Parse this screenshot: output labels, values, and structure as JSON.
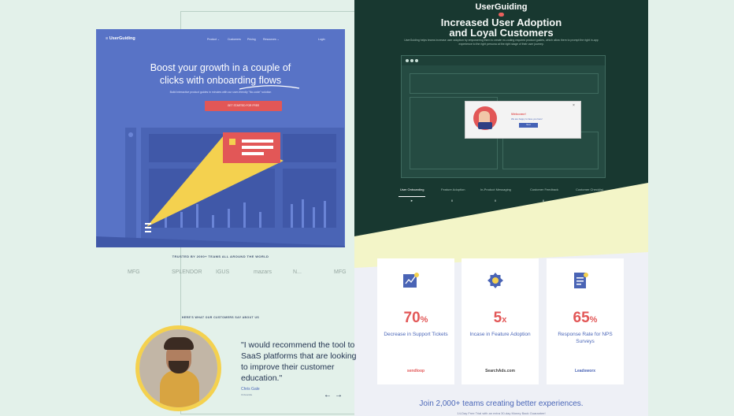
{
  "right": {
    "brand": "UserGuiding",
    "title_line1": "Increased User Adoption",
    "title_line2": "and Loyal Customers",
    "subtitle": "UserGuiding helps teams increase user adoption by empowering them to create no-coding required product guides, which allow them to prompt the right in-app experience to the right persona at the right stage of their user journey.",
    "popup": {
      "title": "Welcome!",
      "text": "We are happy to have you here!",
      "button": "Next",
      "close": "×"
    },
    "tabs": [
      "User Onboarding",
      "Feature Adoption",
      "In-Product Messaging",
      "Customer Feedback",
      "Customer Checklist"
    ],
    "tab_icons": [
      "►",
      "II",
      "II",
      "II",
      "II"
    ],
    "cards": [
      {
        "stat": "70",
        "unit": "%",
        "desc": "Decrease in Support Tickets",
        "brand": "sendloop"
      },
      {
        "stat": "5",
        "unit": "x",
        "desc": "Incase in Feature Adoption",
        "brand": "SearchAds.com"
      },
      {
        "stat": "65",
        "unit": "%",
        "desc": "Response Rate for NPS Surveys",
        "brand": "Leadsworx"
      }
    ],
    "join": "Join 2,000+ teams creating better experiences.",
    "join_sub": "14-Day Free Trial with an extra 30-day Money Back Guarantee!"
  },
  "left": {
    "logo": "UserGuiding",
    "nav": [
      "Product ⌄",
      "Customers",
      "Pricing",
      "Resources ⌄"
    ],
    "login": "Login",
    "cta": "GET STARTED FOR FREE",
    "hero_line1": "Boost your growth in a couple of",
    "hero_line2": "clicks with onboarding flows",
    "hero_sub": "Build interactive product guides in minutes with our user-friendly \"No-code\" solution",
    "hero_button": "GET STARTED FOR FREE",
    "trusted": "TRUSTED BY 2000+ TEAMS ALL AROUND THE WORLD",
    "logos": [
      "MFG",
      "SPLENDOR",
      "IGUS",
      "mazars",
      "N...",
      "MFG"
    ],
    "customers_heading": "HERE'S WHAT OUR CUSTOMERS SAY ABOUT US",
    "quote": "\"I would recommend the tool to SaaS platforms that are looking to improve their customer education.\"",
    "quote_name": "Chris Gale",
    "quote_role": "Onboardia",
    "arrows": "←→"
  }
}
